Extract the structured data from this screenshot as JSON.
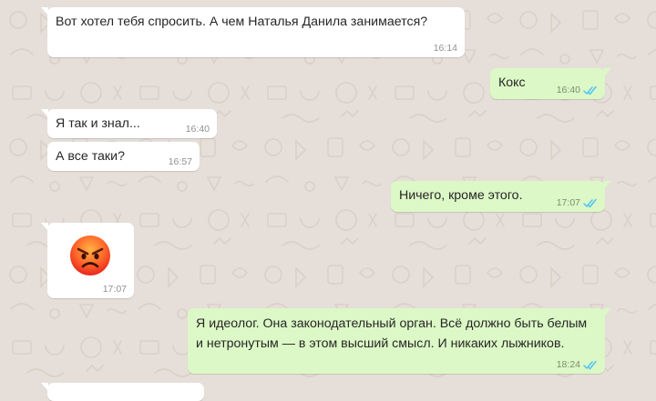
{
  "theme": {
    "wallpaper": "#e6ded8",
    "incoming_bubble": "#ffffff",
    "outgoing_bubble": "#dcf8c6",
    "read_checks": "#4fc3f7"
  },
  "messages": [
    {
      "direction": "incoming",
      "text": "Вот хотел тебя спросить. А чем Наталья Данила занимается?",
      "time": "16:14"
    },
    {
      "direction": "outgoing",
      "text": "Кокс",
      "time": "16:40",
      "status_icon": "double-check-read-icon"
    },
    {
      "direction": "incoming",
      "text": "Я так и знал...",
      "time": "16:40"
    },
    {
      "direction": "incoming",
      "text": "А все таки?",
      "time": "16:57"
    },
    {
      "direction": "outgoing",
      "text": "Ничего, кроме этого.",
      "time": "17:07",
      "status_icon": "double-check-read-icon"
    },
    {
      "direction": "incoming",
      "emoji": "angry-face-icon",
      "time": "17:07"
    },
    {
      "direction": "outgoing",
      "text_lines": [
        "Я идеолог. Она законодательный орган. Всё должно быть белым",
        "и нетронутым — в этом высший смысл. И никаких лыжников."
      ],
      "time": "18:24",
      "status_icon": "double-check-read-icon"
    }
  ]
}
